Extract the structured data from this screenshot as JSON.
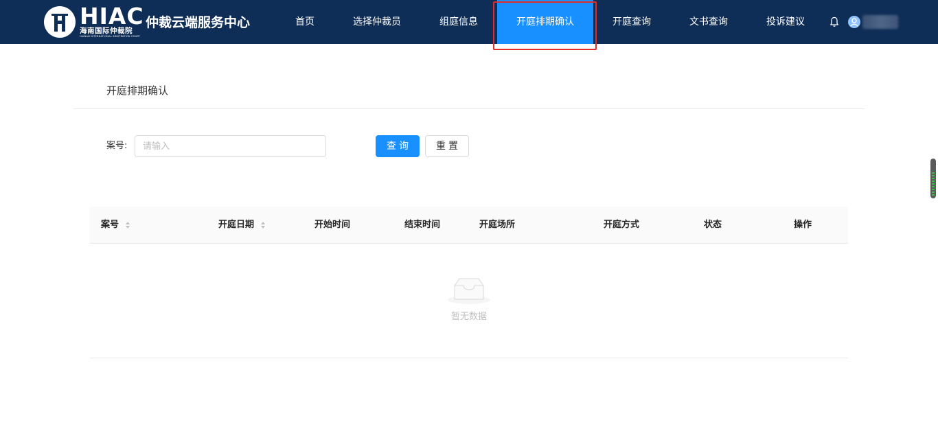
{
  "header": {
    "logo": {
      "abbr": "HIAC",
      "cn_name": "海南国际仲裁院",
      "en_name": "HAINAN INTERNATIONAL ARBITRATION COURT"
    },
    "site_title": "仲裁云端服务中心",
    "nav": [
      {
        "label": "首页",
        "active": false
      },
      {
        "label": "选择仲裁员",
        "active": false
      },
      {
        "label": "组庭信息",
        "active": false
      },
      {
        "label": "开庭排期确认",
        "active": true
      },
      {
        "label": "开庭查询",
        "active": false
      },
      {
        "label": "文书查询",
        "active": false
      },
      {
        "label": "投诉建议",
        "active": false
      }
    ],
    "icons": {
      "notification": "bell-icon",
      "user": "user-avatar-icon"
    },
    "colors": {
      "background": "#0f2e57",
      "active": "#1890ff",
      "highlight": "#e02b2b"
    }
  },
  "page": {
    "title": "开庭排期确认"
  },
  "filter": {
    "case_label": "案号:",
    "case_placeholder": "请输入",
    "case_value": "",
    "search_label": "查询",
    "reset_label": "重置"
  },
  "table": {
    "columns": [
      {
        "label": "案号",
        "sortable": true
      },
      {
        "label": "开庭日期",
        "sortable": true
      },
      {
        "label": "开始时间",
        "sortable": false
      },
      {
        "label": "结束时间",
        "sortable": false
      },
      {
        "label": "开庭场所",
        "sortable": false
      },
      {
        "label": "开庭方式",
        "sortable": false
      },
      {
        "label": "状态",
        "sortable": false
      },
      {
        "label": "操作",
        "sortable": false
      }
    ],
    "rows": [],
    "empty_text": "暂无数据",
    "empty_icon": "empty-inbox-icon"
  }
}
